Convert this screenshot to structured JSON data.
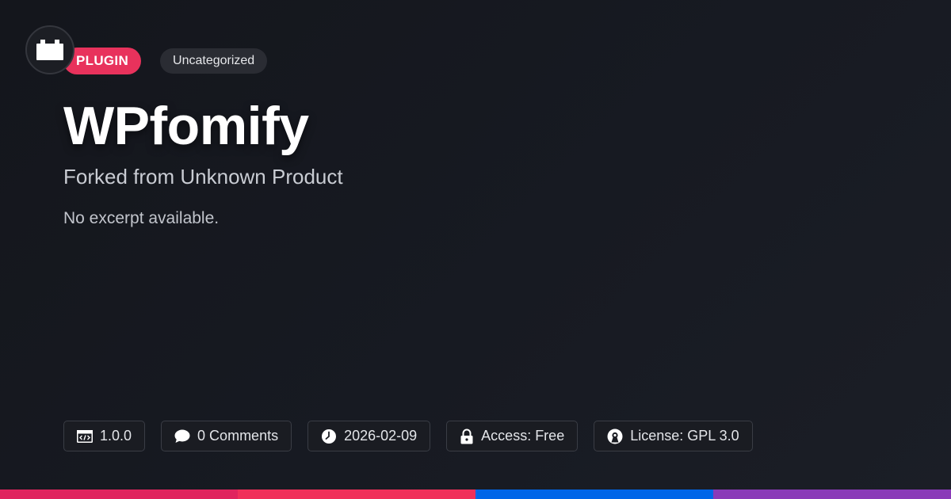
{
  "header": {
    "logo_icon": "plug-icon",
    "type_tag": "PLUGIN",
    "category_tag": "Uncategorized"
  },
  "main": {
    "title": "WPfomify",
    "subtitle": "Forked from Unknown Product",
    "excerpt": "No excerpt available."
  },
  "meta": {
    "version": {
      "icon": "code-icon",
      "label": "1.0.0"
    },
    "comments": {
      "icon": "comment-icon",
      "label": "0 Comments"
    },
    "date": {
      "icon": "clock-icon",
      "label": "2026-02-09"
    },
    "access": {
      "icon": "lock-icon",
      "label": "Access: Free"
    },
    "license": {
      "icon": "open-source-icon",
      "label": "License: GPL 3.0"
    }
  },
  "colors": {
    "plugin_tag": "#e8325c",
    "stripe": [
      "#e0245e",
      "#f0305a",
      "#0066e8",
      "#8a3ab8"
    ]
  }
}
